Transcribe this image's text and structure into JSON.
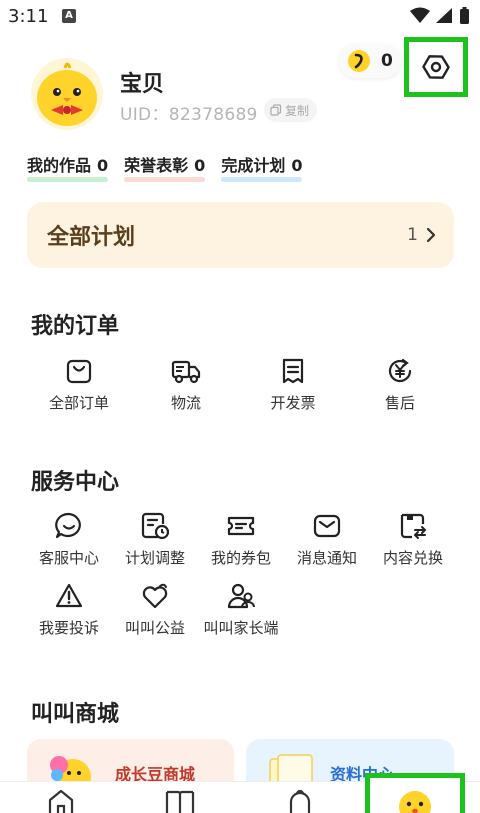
{
  "status_bar": {
    "time": "3:11",
    "notification_icon": "A"
  },
  "profile": {
    "username": "宝贝",
    "uid": "UID：82378689",
    "copy_label": "复制",
    "coins": "0"
  },
  "stats": [
    {
      "label": "我的作品",
      "value": "0",
      "color": "#c8f0cf"
    },
    {
      "label": "荣誉表彰",
      "value": "0",
      "color": "#fbd9d4"
    },
    {
      "label": "完成计划",
      "value": "0",
      "color": "#cfe6fb"
    }
  ],
  "plans": {
    "title": "全部计划",
    "count": "1"
  },
  "orders": {
    "title": "我的订单",
    "items": [
      {
        "label": "全部订单",
        "icon": "shopping-bag-icon"
      },
      {
        "label": "物流",
        "icon": "delivery-truck-icon"
      },
      {
        "label": "开发票",
        "icon": "receipt-icon"
      },
      {
        "label": "售后",
        "icon": "yen-refresh-icon"
      }
    ]
  },
  "services": {
    "title": "服务中心",
    "row1": [
      {
        "label": "客服中心",
        "icon": "chat-bubble-icon"
      },
      {
        "label": "计划调整",
        "icon": "schedule-clock-icon"
      },
      {
        "label": "我的券包",
        "icon": "coupon-icon"
      },
      {
        "label": "消息通知",
        "icon": "envelope-icon"
      },
      {
        "label": "内容兑换",
        "icon": "exchange-icon"
      }
    ],
    "row2": [
      {
        "label": "我要投诉",
        "icon": "warning-icon"
      },
      {
        "label": "叫叫公益",
        "icon": "heart-hands-icon"
      },
      {
        "label": "叫叫家长端",
        "icon": "parents-icon"
      }
    ]
  },
  "mall": {
    "title": "叫叫商城",
    "cards": [
      {
        "label": "成长豆商城",
        "color": "#c0392b",
        "bg": "#fdeee8"
      },
      {
        "label": "资料中心",
        "color": "#2a6fd6",
        "bg": "#e8f4fd"
      }
    ]
  },
  "bottom_nav": [
    {
      "name": "home-icon"
    },
    {
      "name": "book-icon"
    },
    {
      "name": "bell-icon"
    },
    {
      "name": "me-face-icon"
    }
  ],
  "colors": {
    "highlight_frame": "#1dc21d",
    "accent_yellow": "#ffd32a"
  }
}
